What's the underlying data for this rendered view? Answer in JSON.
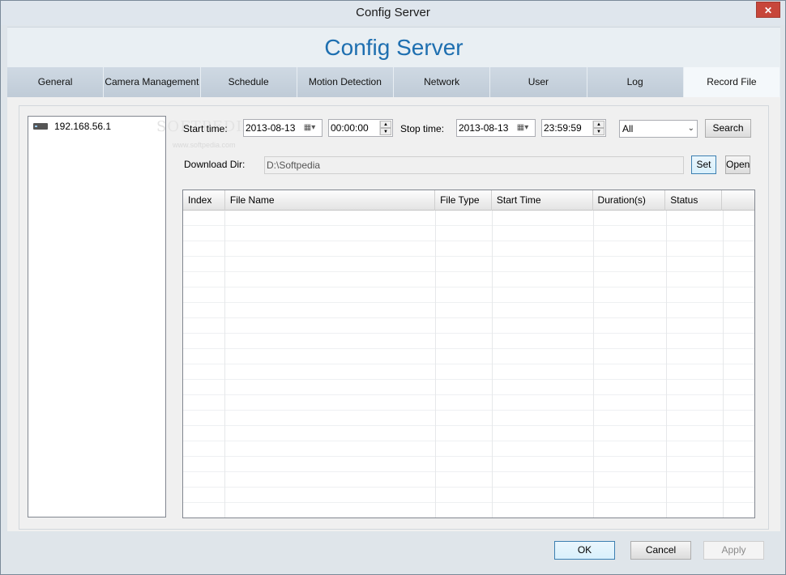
{
  "window": {
    "title": "Config Server",
    "close_glyph": "✕"
  },
  "banner": {
    "title": "Config Server"
  },
  "tabs": [
    {
      "label": "General"
    },
    {
      "label": "Camera Management"
    },
    {
      "label": "Schedule"
    },
    {
      "label": "Motion Detection"
    },
    {
      "label": "Network"
    },
    {
      "label": "User"
    },
    {
      "label": "Log"
    },
    {
      "label": "Record File"
    }
  ],
  "active_tab": "Record File",
  "tree": {
    "items": [
      {
        "label": "192.168.56.1",
        "icon": "device-icon"
      }
    ]
  },
  "watermark": {
    "main": "SOFTPEDIA",
    "sub": "www.softpedia.com"
  },
  "search": {
    "start_label": "Start time:",
    "start_date": "2013-08-13",
    "start_time": "00:00:00",
    "stop_label": "Stop time:",
    "stop_date": "2013-08-13",
    "stop_time": "23:59:59",
    "filter_value": "All",
    "search_button": "Search"
  },
  "download": {
    "label": "Download Dir:",
    "path": "D:\\Softpedia",
    "set_button": "Set",
    "open_button": "Open"
  },
  "table": {
    "columns": [
      "Index",
      "File Name",
      "File Type",
      "Start Time",
      "Duration(s)",
      "Status",
      ""
    ],
    "rows": []
  },
  "footer": {
    "ok": "OK",
    "cancel": "Cancel",
    "apply": "Apply"
  }
}
